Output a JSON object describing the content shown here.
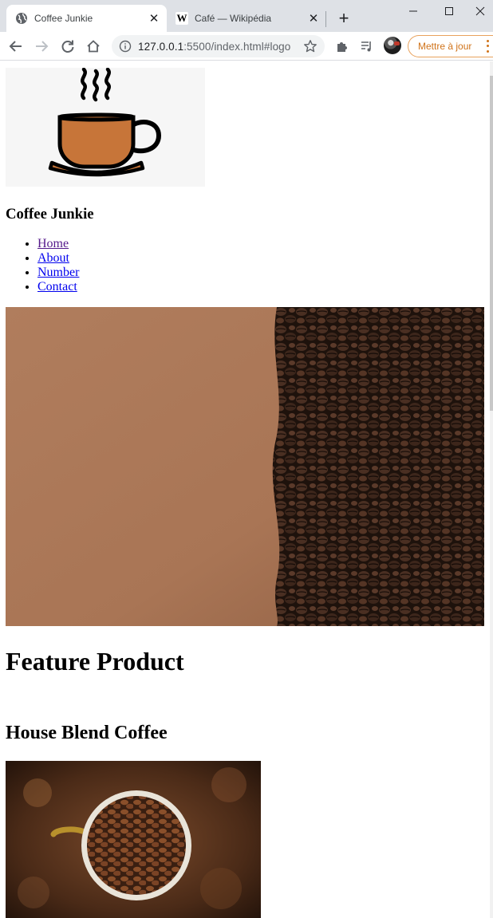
{
  "browser": {
    "tabs": [
      {
        "title": "Coffee Junkie",
        "active": true
      },
      {
        "title": "Café — Wikipédia",
        "active": false
      }
    ],
    "url_host": "127.0.0.1",
    "url_rest": ":5500/index.html#logo",
    "update_button": "Mettre à jour",
    "accent_color": "#d0731a"
  },
  "page": {
    "site_title": "Coffee Junkie",
    "nav": [
      "Home",
      "About",
      "Number",
      "Contact"
    ],
    "feature_heading": "Feature Product",
    "product_name": "House Blend Coffee"
  }
}
